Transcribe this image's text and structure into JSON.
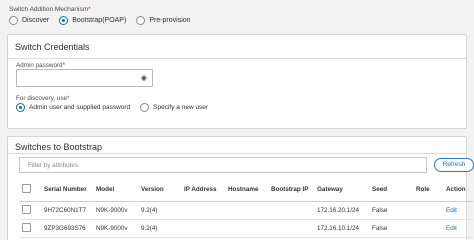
{
  "mechanism": {
    "title": "Switch Addition Mechanism",
    "required_mark": "*",
    "options": [
      {
        "label": "Discover",
        "selected": false
      },
      {
        "label": "Bootstrap(POAP)",
        "selected": true
      },
      {
        "label": "Pre-provision",
        "selected": false
      }
    ]
  },
  "credentials": {
    "title": "Switch Credentials",
    "password_label": "Admin password",
    "required_mark": "*",
    "password_value": "",
    "show_password_icon": "eye-icon",
    "discovery_label": "For discovery, use",
    "discovery_options": [
      {
        "label": "Admin user and supplied password",
        "selected": true
      },
      {
        "label": "Specify a new user",
        "selected": false
      }
    ]
  },
  "bootstrap": {
    "title": "Switches to Bootstrap",
    "filter_placeholder": "Filter by attributes",
    "refresh_label": "Refresh",
    "columns": [
      "Serial Number",
      "Model",
      "Version",
      "IP Address",
      "Hostname",
      "Bootstrap IP",
      "Gateway",
      "Seed",
      "Role",
      "Action"
    ],
    "rows": [
      {
        "serial": "9H72C60N1T7",
        "model": "N9K-9000v",
        "version": "9.2(4)",
        "ip": "",
        "hostname": "",
        "bootstrap_ip": "",
        "gateway": "172.16.20.1/24",
        "seed": "False",
        "role": "",
        "action": "Edit"
      },
      {
        "serial": "9ZP3G693S76",
        "model": "N9K-9000v",
        "version": "9.2(4)",
        "ip": "",
        "hostname": "",
        "bootstrap_ip": "",
        "gateway": "172.16.10.1/24",
        "seed": "False",
        "role": "",
        "action": "Edit"
      }
    ]
  },
  "colors": {
    "accent": "#0d6ebd",
    "required": "#d8232a",
    "link": "#1c6eb8"
  }
}
